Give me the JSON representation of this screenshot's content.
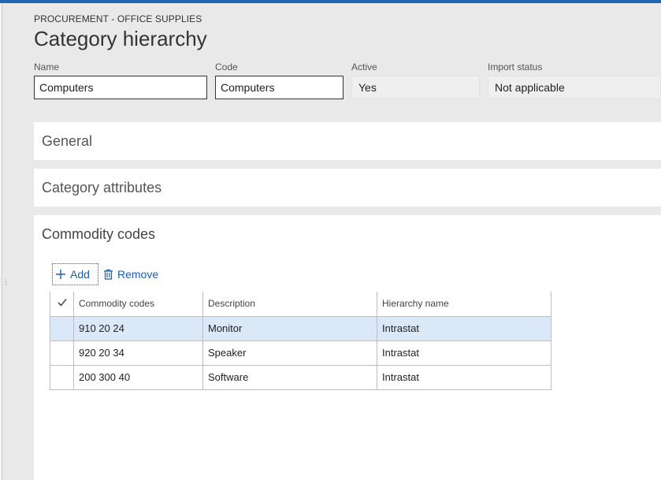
{
  "header": {
    "breadcrumb": "PROCUREMENT - OFFICE SUPPLIES",
    "title": "Category hierarchy"
  },
  "fields": {
    "name": {
      "label": "Name",
      "value": "Computers"
    },
    "code": {
      "label": "Code",
      "value": "Computers"
    },
    "active": {
      "label": "Active",
      "value": "Yes"
    },
    "import_status": {
      "label": "Import status",
      "value": "Not applicable"
    }
  },
  "panels": {
    "general": "General",
    "category_attributes": "Category attributes",
    "commodity_codes": "Commodity codes"
  },
  "toolbar": {
    "add_label": "Add",
    "remove_label": "Remove"
  },
  "grid": {
    "columns": [
      "Commodity codes",
      "Description",
      "Hierarchy name"
    ],
    "rows": [
      {
        "code": "910 20 24",
        "description": "Monitor",
        "hierarchy": "Intrastat",
        "selected": true
      },
      {
        "code": "920 20 34",
        "description": "Speaker",
        "hierarchy": "Intrastat",
        "selected": false
      },
      {
        "code": "200 300 40",
        "description": "Software",
        "hierarchy": "Intrastat",
        "selected": false
      }
    ]
  },
  "colors": {
    "accent": "#2266b3",
    "link": "#1e5fa8",
    "selected_row": "#dbe8f7"
  },
  "icons": {
    "add": "plus-icon",
    "remove": "trash-icon",
    "select_all": "checkmark-icon"
  }
}
